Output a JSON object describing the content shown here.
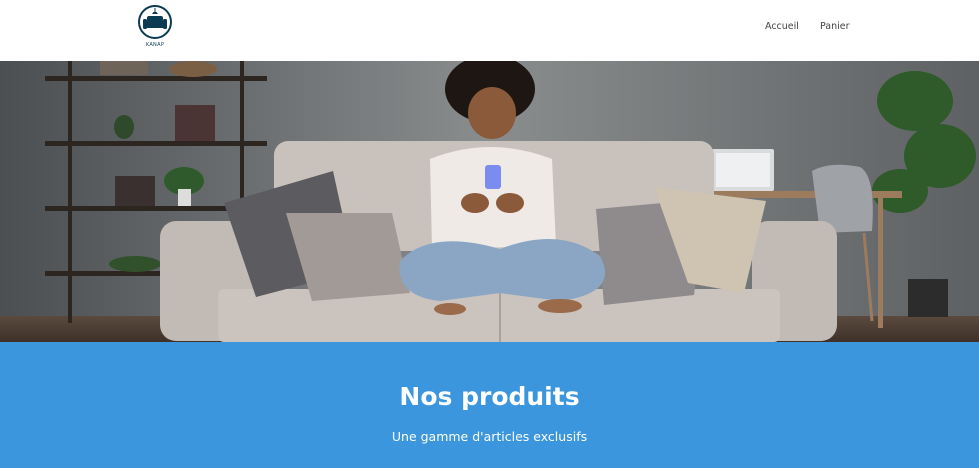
{
  "header": {
    "logo_text": "KANAP",
    "nav": [
      {
        "label": "Accueil"
      },
      {
        "label": "Panier"
      }
    ]
  },
  "hero": {
    "icon": "hero-photo-woman-on-sofa"
  },
  "products": {
    "title": "Nos produits",
    "subtitle": "Une gamme d'articles exclusifs"
  },
  "colors": {
    "band": "#3b96de",
    "logo": "#0b3b53"
  }
}
